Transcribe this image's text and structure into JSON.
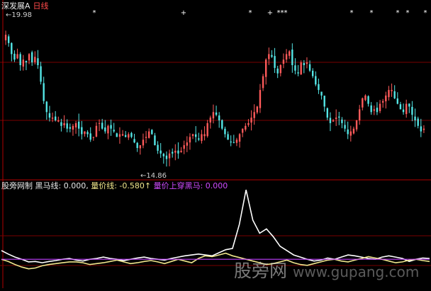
{
  "header": {
    "stock_name": "深发展A",
    "period": "日线"
  },
  "price_panel": {
    "high_label": "19.98",
    "low_label": "14.86"
  },
  "indicator_bar": {
    "source": "股旁网制",
    "heima_label": "黑马线: 0.000,",
    "liangjia_label": "量价线: -0.580",
    "arrow": "↑",
    "cross_label": "量价上穿黑马: 0.000"
  },
  "watermark": {
    "cn": "股旁网",
    "url": "www.gupang.com"
  },
  "colors": {
    "background": "#000000",
    "up_candle": "#ff5a5a",
    "down_candle": "#54e6e6",
    "grid": "#7a0000",
    "separator": "#b00000",
    "white_line": "#ffffff",
    "yellow_line": "#f0e68c",
    "purple_line": "#c040ff"
  },
  "chart_data": [
    {
      "type": "candlestick",
      "title": "深发展A 日线",
      "ylim": [
        14.5,
        20.5
      ],
      "high": 19.98,
      "low": 14.86,
      "closes": [
        19.6,
        19.3,
        18.9,
        18.7,
        18.9,
        18.5,
        18.7,
        18.6,
        18.9,
        18.6,
        18.8,
        18.5,
        17.9,
        17.2,
        16.8,
        16.6,
        16.6,
        16.5,
        16.5,
        16.3,
        16.4,
        16.2,
        16.2,
        16.3,
        16.4,
        16.2,
        16.0,
        16.1,
        16.0,
        15.8,
        15.9,
        16.3,
        16.4,
        16.2,
        16.1,
        16.3,
        16.2,
        16.1,
        15.9,
        16.0,
        16.0,
        15.9,
        16.0,
        15.9,
        15.7,
        15.5,
        15.6,
        15.8,
        15.9,
        16.1,
        16.0,
        15.6,
        15.4,
        15.3,
        15.2,
        15.1,
        15.3,
        15.3,
        15.4,
        15.3,
        15.4,
        15.6,
        15.7,
        15.9,
        16.0,
        15.9,
        15.8,
        16.0,
        16.0,
        16.4,
        16.6,
        16.8,
        16.7,
        16.5,
        16.2,
        16.0,
        15.8,
        15.7,
        15.7,
        15.8,
        16.0,
        16.2,
        16.3,
        16.4,
        16.6,
        16.8,
        17.0,
        17.6,
        18.1,
        18.7,
        18.9,
        18.8,
        18.4,
        18.2,
        18.5,
        18.7,
        18.9,
        19.0,
        18.5,
        18.3,
        18.2,
        18.6,
        18.5,
        18.6,
        18.3,
        18.1,
        17.8,
        17.6,
        17.4,
        17.0,
        16.6,
        16.4,
        16.5,
        16.6,
        16.6,
        16.4,
        16.2,
        16.0,
        16.1,
        16.2,
        16.5,
        16.9,
        17.3,
        17.4,
        17.1,
        16.8,
        16.9,
        16.8,
        17.1,
        17.2,
        17.4,
        17.6,
        17.6,
        17.3,
        17.1,
        16.9,
        16.8,
        17.1,
        17.0,
        16.7,
        16.5,
        16.3,
        16.1,
        16.2
      ],
      "markers": [
        "*",
        "+",
        "*",
        "+",
        "*",
        "*",
        "*",
        "*",
        "*",
        "*",
        "*",
        "*",
        "+",
        "+",
        "*"
      ]
    },
    {
      "type": "line",
      "title": "股旁网制",
      "series": [
        {
          "name": "黑马线",
          "values": [
            0.2,
            0.12,
            0.05,
            0.0,
            -0.06,
            -0.05,
            -0.08,
            -0.05,
            -0.03,
            0.0,
            0.02,
            -0.02,
            -0.04,
            0.0,
            0.02,
            0.05,
            0.02,
            0.0,
            -0.03,
            0.0,
            0.03,
            0.05,
            0.02,
            0.0,
            -0.02,
            0.02,
            0.05,
            0.08,
            0.1,
            0.12,
            0.1,
            0.08,
            0.15,
            0.22,
            0.25,
            0.8,
            1.6,
            0.9,
            0.6,
            0.7,
            0.52,
            0.3,
            0.2,
            0.1,
            0.05,
            0.0,
            -0.04,
            -0.02,
            0.03,
            0.0,
            0.05,
            0.1,
            0.08,
            0.05,
            0.02,
            0.0,
            0.05,
            0.08,
            0.05,
            0.02,
            -0.05,
            0.0,
            0.03,
            0.02
          ]
        },
        {
          "name": "量价线",
          "values": [
            0.0,
            -0.05,
            -0.12,
            -0.18,
            -0.22,
            -0.2,
            -0.15,
            -0.12,
            -0.1,
            -0.08,
            -0.06,
            -0.06,
            -0.08,
            -0.12,
            -0.1,
            -0.08,
            -0.05,
            -0.02,
            -0.06,
            -0.1,
            -0.08,
            -0.05,
            -0.03,
            -0.06,
            -0.1,
            -0.05,
            0.0,
            -0.04,
            -0.08,
            0.02,
            0.08,
            0.06,
            0.1,
            0.14,
            0.08,
            0.04,
            0.0,
            -0.04,
            -0.08,
            -0.12,
            -0.1,
            -0.06,
            -0.02,
            -0.08,
            -0.12,
            -0.14,
            -0.1,
            -0.06,
            -0.02,
            0.0,
            -0.04,
            -0.06,
            -0.02,
            0.02,
            0.06,
            0.03,
            0.0,
            -0.04,
            -0.08,
            -0.06,
            -0.02,
            0.0,
            -0.03,
            -0.05
          ]
        },
        {
          "name": "量价上穿黑马",
          "values": [
            0.0,
            0.0,
            0.0,
            0.0,
            0.0,
            0.0,
            0.0,
            0.0,
            0.0,
            0.0,
            0.0,
            0.0,
            0.0,
            0.0,
            0.0,
            0.0,
            0.0,
            0.0,
            0.0,
            0.0,
            0.0,
            0.0,
            0.0,
            0.0,
            0.0,
            0.0,
            0.0,
            0.0,
            0.0,
            0.0,
            0.0,
            0.0,
            0.0,
            0.0,
            0.0,
            0.0,
            0.0,
            0.0,
            0.0,
            0.0,
            0.0,
            0.0,
            0.0,
            0.0,
            0.0,
            0.0,
            0.0,
            0.0,
            0.0,
            0.0,
            0.0,
            0.0,
            0.0,
            0.0,
            0.0,
            0.0,
            0.0,
            0.0,
            0.0,
            0.0,
            0.0,
            0.0,
            0.0,
            0.0
          ]
        }
      ],
      "ylim": [
        -0.6,
        1.65
      ],
      "peak_value": 1.6
    }
  ]
}
